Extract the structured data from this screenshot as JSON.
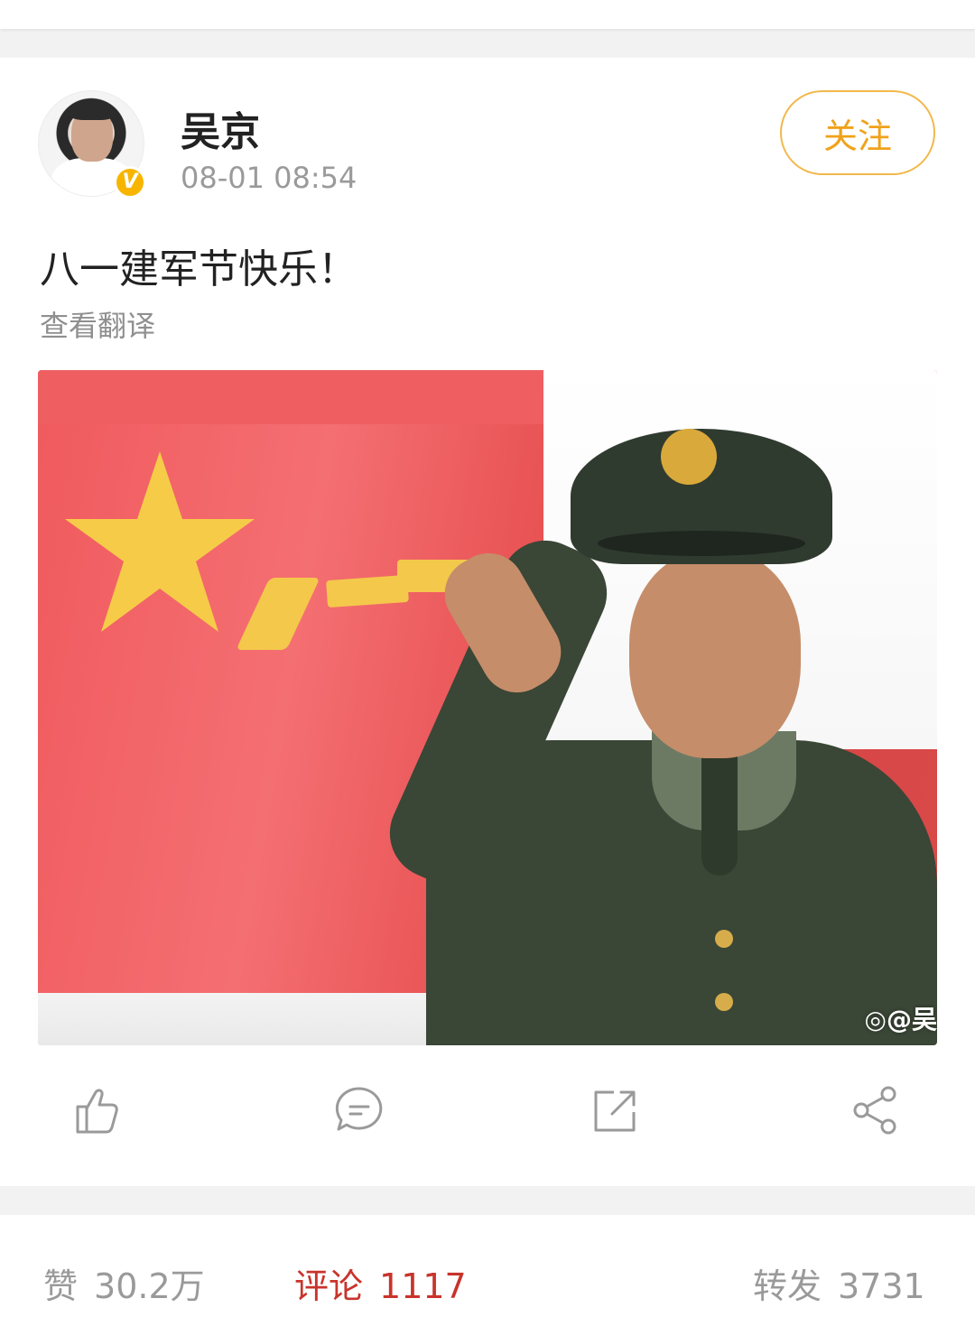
{
  "post": {
    "author": "吴京",
    "timestamp": "08-01 08:54",
    "follow_label": "关注",
    "verified_badge": "V",
    "text": "八一建军节快乐！",
    "translate_label": "查看翻译",
    "image_watermark": "@吴",
    "image_description_icon": "weibo-watermark-icon"
  },
  "actions": {
    "like_icon": "thumbs-up-icon",
    "comment_icon": "comment-icon",
    "repost_icon": "share-external-icon",
    "share_icon": "share-nodes-icon"
  },
  "stats": {
    "likes_label": "赞",
    "likes_count": "30.2万",
    "comments_label": "评论",
    "comments_count": "1117",
    "reposts_label": "转发",
    "reposts_count": "3731"
  },
  "colors": {
    "follow_accent": "#f0a21a",
    "active_tab": "#c8342c",
    "muted_text": "#9a9a9a",
    "verified_badge": "#f7b500"
  }
}
